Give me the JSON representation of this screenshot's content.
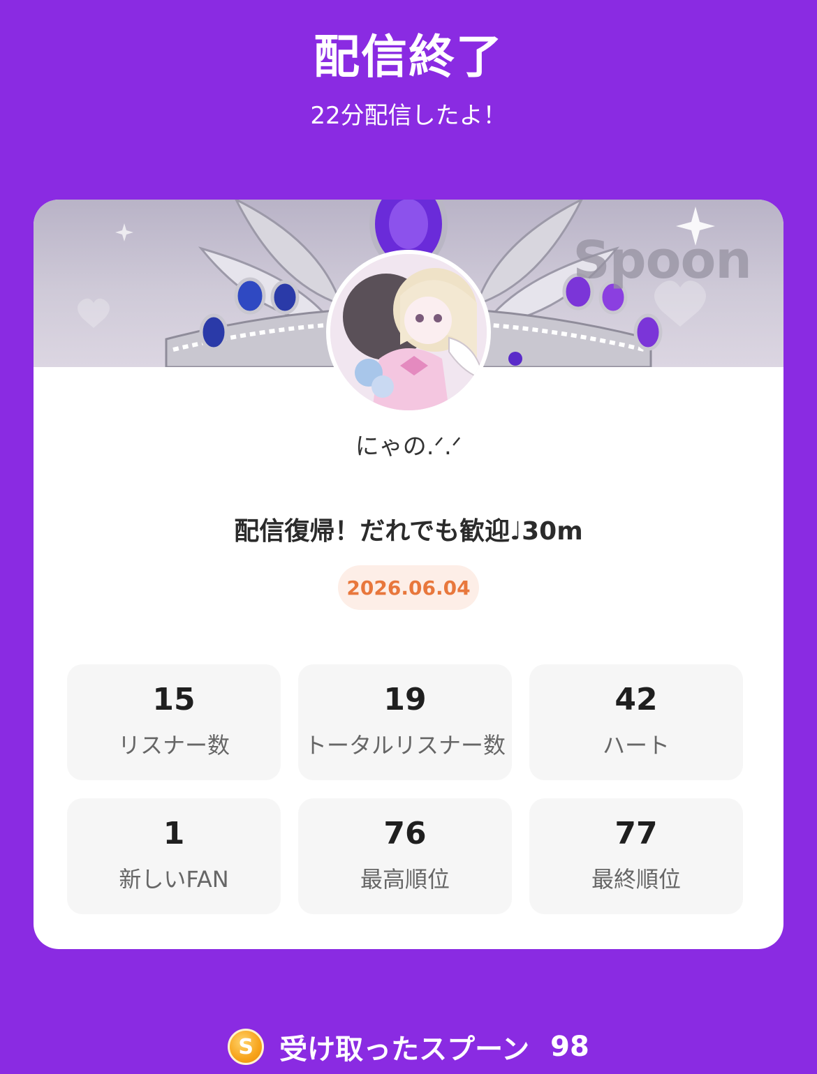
{
  "header": {
    "title": "配信終了",
    "subtitle": "22分配信したよ！"
  },
  "card": {
    "banner_watermark": "Spoon",
    "username": "にゃの.ᐟ.ᐟ",
    "live_title": "配信復帰！だれでも歓迎♩30m",
    "date": "2026.06.04"
  },
  "stats": [
    {
      "value": "15",
      "label": "リスナー数"
    },
    {
      "value": "19",
      "label": "トータルリスナー数"
    },
    {
      "value": "42",
      "label": "ハート"
    },
    {
      "value": "1",
      "label": "新しいFAN"
    },
    {
      "value": "76",
      "label": "最高順位"
    },
    {
      "value": "77",
      "label": "最終順位"
    }
  ],
  "spoons": {
    "coin_symbol": "S",
    "label": "受け取ったスプーン",
    "count": "98"
  },
  "colors": {
    "background": "#8a2be2",
    "date_text": "#e8773c",
    "date_bg": "#fdeee7"
  },
  "icons": {
    "coin": "spoon-coin-icon",
    "avatar": "user-avatar"
  }
}
